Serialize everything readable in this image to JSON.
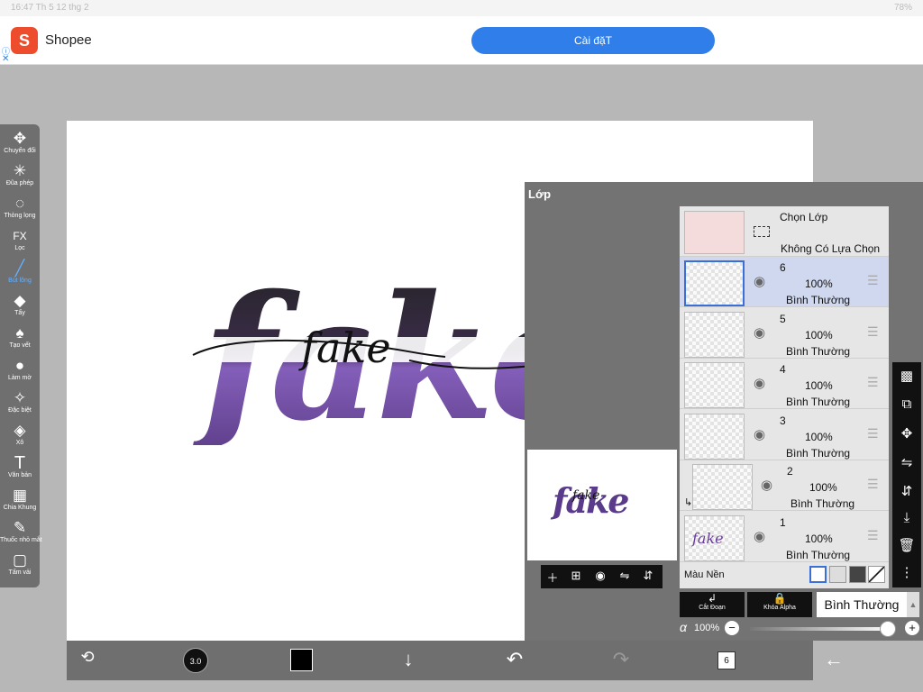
{
  "status_bar": {
    "time": "16:47 Th 5 12 thg 2",
    "battery": "78%"
  },
  "ad": {
    "app_name": "Shopee",
    "logo_letter": "S",
    "install_label": "Cài đặT"
  },
  "artwork": {
    "word_outline": "fake",
    "word_script": "fake"
  },
  "left_toolbar": {
    "tools": [
      {
        "label": "Chuyển đổi",
        "icon": "move-icon"
      },
      {
        "label": "Đũa phép",
        "icon": "magic-wand-icon"
      },
      {
        "label": "Thòng lọng",
        "icon": "lasso-icon"
      },
      {
        "label": "Lọc",
        "icon": "fx-icon",
        "glyph": "FX"
      },
      {
        "label": "Bút lông",
        "icon": "brush-icon",
        "active": true
      },
      {
        "label": "Tẩy",
        "icon": "eraser-icon"
      },
      {
        "label": "Tạo vết",
        "icon": "smudge-icon"
      },
      {
        "label": "Làm mờ",
        "icon": "blur-icon"
      },
      {
        "label": "Đặc biệt",
        "icon": "special-icon"
      },
      {
        "label": "Xô",
        "icon": "bucket-icon"
      },
      {
        "label": "Văn bản",
        "icon": "text-icon",
        "glyph": "T"
      },
      {
        "label": "Chia Khung",
        "icon": "frame-divider-icon"
      },
      {
        "label": "Thuốc nhỏ mắt",
        "icon": "eyedropper-icon"
      },
      {
        "label": "Tấm vải",
        "icon": "canvas-icon"
      }
    ]
  },
  "layer_panel": {
    "title": "Lớp",
    "selection": {
      "title": "Chọn Lớp",
      "subtitle": "Không Có Lựa Chọn"
    },
    "layers": [
      {
        "number": "6",
        "opacity": "100%",
        "blend": "Bình Thường",
        "selected": true
      },
      {
        "number": "5",
        "opacity": "100%",
        "blend": "Bình Thường"
      },
      {
        "number": "4",
        "opacity": "100%",
        "blend": "Bình Thường"
      },
      {
        "number": "3",
        "opacity": "100%",
        "blend": "Bình Thường"
      },
      {
        "number": "2",
        "opacity": "100%",
        "blend": "Bình Thường",
        "clipped": true
      },
      {
        "number": "1",
        "opacity": "100%",
        "blend": "Bình Thường"
      }
    ],
    "background": {
      "label": "Màu Nền"
    },
    "clip_label": "Cắt Đoạn",
    "alpha_lock_label": "Khóa Alpha",
    "blend_mode": "Bình Thường",
    "opacity_value": "100%"
  },
  "bottom_toolbar": {
    "brush_size": "3.0",
    "layer_count": "6"
  },
  "colors": {
    "accent": "#3b6fd3",
    "purple": "#6a3c9c",
    "panel": "#737373"
  }
}
